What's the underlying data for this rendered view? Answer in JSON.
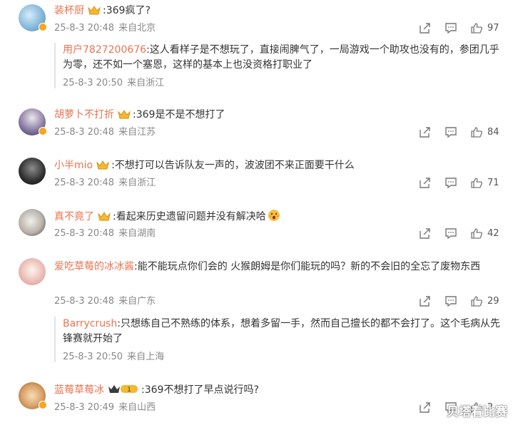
{
  "comments": [
    {
      "username": "装杯厨",
      "text": ":369疯了?",
      "date": "25-8-3 20:48",
      "location": "来自北京",
      "likes": "97",
      "avatar_color": "#7fb3d8",
      "reply": {
        "username": "用户7827200676",
        "text": ":这人看样子是不想玩了，直接闹脾气了，一局游戏一个助攻也没有的，参团几乎为零，还不如一个塞恩，这样的基本上也没资格打职业了",
        "date": "25-8-3 20:50",
        "location": "来自浙江"
      }
    },
    {
      "username": "胡萝卜不打折",
      "text": ":369是不是不想打了",
      "date": "25-8-3 20:48",
      "location": "来自江苏",
      "likes": "84",
      "avatar_color": "#8a7fa8"
    },
    {
      "username": "小半mio",
      "text": ":不想打可以告诉队友一声的，波波团不来正面要干什么",
      "date": "25-8-3 20:48",
      "location": "来自浙江",
      "likes": "71",
      "avatar_color": "#2f2f2f"
    },
    {
      "username": "真不竟了",
      "text": ":看起来历史遗留问题并没有解决哈",
      "date": "25-8-3 20:48",
      "location": "来自湖南",
      "likes": "42",
      "avatar_color": "#b9b4ad"
    },
    {
      "username": "爱吃草莓的冰冰酱",
      "text": ":能不能玩点你们会的 火猴朗姆是你们能玩的吗？新的不会旧的全忘了废物东西",
      "date": "25-8-3 20:48",
      "location": "来自广东",
      "likes": "29",
      "avatar_color": "#e9b9b0",
      "reply": {
        "username": "Barrycrush",
        "text": ":只想练自己不熟练的体系，想着多留一手，然而自己擅长的都不会打了。这个毛病从先锋赛就开始了",
        "date": "25-8-3 20:50",
        "location": "来自上海"
      }
    },
    {
      "username": "蓝莓草莓冰",
      "text": ":369不想打了早点说行吗?",
      "date": "25-8-3 20:49",
      "location": "来自山西",
      "likes": "2",
      "avatar_color": "#d9a066"
    }
  ],
  "icons": {
    "share": "share-icon",
    "comment": "comment-icon",
    "like": "thumbs-up-icon"
  },
  "watermark": "贝塔看比赛"
}
